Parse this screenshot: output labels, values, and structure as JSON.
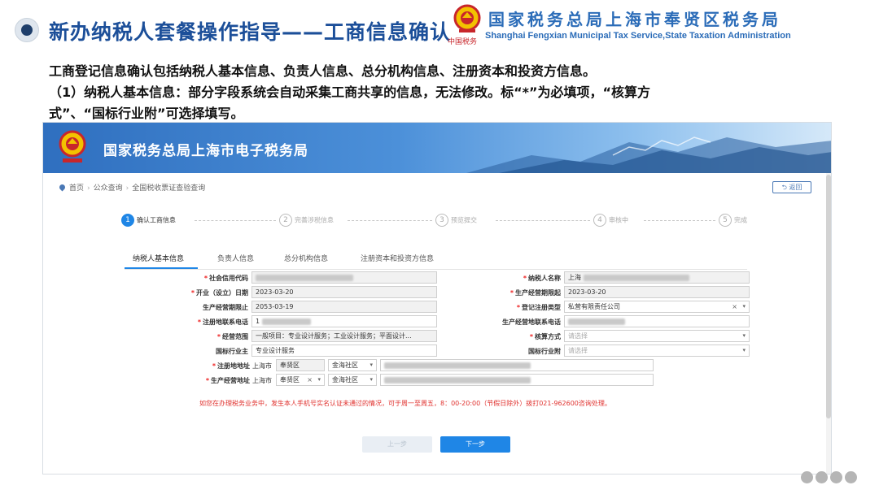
{
  "slide": {
    "title": "新办纳税人套餐操作指导——工商信息确认",
    "office_cn": "国家税务总局上海市奉贤区税务局",
    "office_en": "Shanghai Fengxian Municipal Tax Service,State Taxation Administration",
    "emblem_signature": "中国税务",
    "intro_lines": [
      "工商登记信息确认包括纳税人基本信息、负责人信息、总分机构信息、注册资本和投资方信息。",
      "（1）纳税人基本信息：部分字段系统会自动采集工商共享的信息，无法修改。标“*”为必填项，“核算方",
      "式”、“国标行业附”可选择填写。"
    ]
  },
  "portal": {
    "title": "国家税务总局上海市电子税务局",
    "logo_signature": "中国税务",
    "breadcrumb": [
      "首页",
      "公众查询",
      "全国税收票证查验查询"
    ],
    "back_label": "返回",
    "steps": [
      {
        "num": "1",
        "label": "确认工商信息"
      },
      {
        "num": "2",
        "label": "完善涉税信息"
      },
      {
        "num": "3",
        "label": "预览提交"
      },
      {
        "num": "4",
        "label": "审核中"
      },
      {
        "num": "5",
        "label": "完成"
      }
    ],
    "tabs": [
      "纳税人基本信息",
      "负责人信息",
      "总分机构信息",
      "注册资本和投资方信息"
    ],
    "form": {
      "credit_code_label": "社会信用代码",
      "taxpayer_name_label": "纳税人名称",
      "taxpayer_name_value": "上海",
      "open_date_label": "开业（设立）日期",
      "open_date_value": "2023-03-20",
      "period_start_label": "生产经营期限起",
      "period_start_value": "2023-03-20",
      "period_end_label": "生产经营期限止",
      "period_end_value": "2053-03-19",
      "reg_type_label": "登记注册类型",
      "reg_type_value": "私营有限责任公司",
      "reg_phone_label": "注册地联系电话",
      "reg_phone_value": "1",
      "biz_phone_label": "生产经营地联系电话",
      "scope_label": "经营范围",
      "scope_value": "一般项目：专业设计服务；工业设计服务；平面设计...",
      "accounting_label": "核算方式",
      "accounting_placeholder": "请选择",
      "industry_label": "国标行业主",
      "industry_value": "专业设计服务",
      "industry_sub_label": "国标行业附",
      "industry_sub_placeholder": "请选择",
      "reg_addr_label": "注册地地址",
      "reg_addr_city": "上海市",
      "reg_addr_district": "奉贤区",
      "reg_addr_town": "金海社区",
      "biz_addr_label": "生产经营地址",
      "biz_addr_city": "上海市",
      "biz_addr_district": "奉贤区",
      "biz_addr_town": "金海社区"
    },
    "notice": "如您在办理税务业务中，发生本人手机号实名认证未通过的情况，可于周一至周五，8：00-20:00（节假日除外）拨打021-962600咨询处理。",
    "prev_label": "上一步",
    "next_label": "下一步"
  },
  "colors": {
    "title_blue": "#1c4f99",
    "office_blue": "#2b6cb8",
    "primary": "#1f86e6",
    "required_red": "#e22222",
    "notice_red": "#e0312e"
  }
}
